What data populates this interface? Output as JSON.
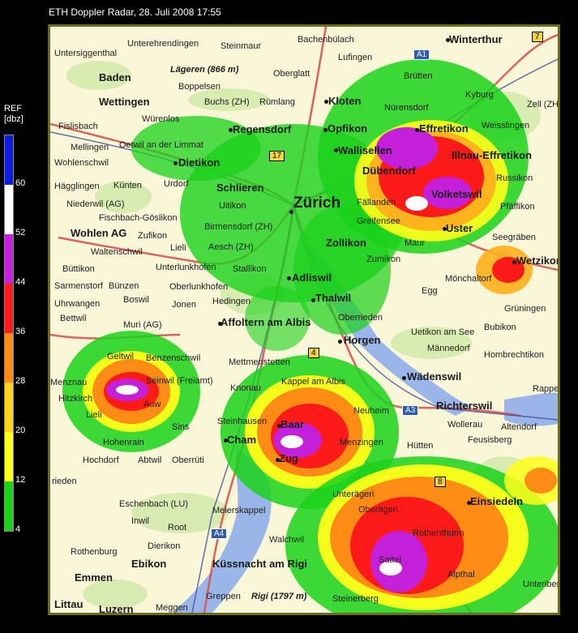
{
  "title": "ETH Doppler Radar, 28. Juli 2008 17:55",
  "legend": {
    "label_line1": "REF",
    "label_line2": "[dbz]",
    "ticks": [
      "60",
      "52",
      "44",
      "36",
      "28",
      "20",
      "12",
      "4"
    ],
    "colors": [
      "#0a1de0",
      "#ffffff",
      "#c41fd9",
      "#ff1a1a",
      "#ff8c14",
      "#ffd21a",
      "#ffff1a",
      "#1ad21a"
    ]
  },
  "map": {
    "places": [
      {
        "id": "unterehrendingen",
        "text": "Unterehrendingen",
        "cls": ""
      },
      {
        "id": "steinmaur",
        "text": "Steinmaur",
        "cls": ""
      },
      {
        "id": "bachenbulach",
        "text": "Bachenbülach",
        "cls": ""
      },
      {
        "id": "winterthur",
        "text": "Winterthur",
        "cls": "big"
      },
      {
        "id": "untersiggenthal",
        "text": "Untersiggenthal",
        "cls": ""
      },
      {
        "id": "lufingen",
        "text": "Lufingen",
        "cls": ""
      },
      {
        "id": "lagern",
        "text": "Lägeren (866 m)",
        "cls": "it"
      },
      {
        "id": "oberglatt",
        "text": "Oberglatt",
        "cls": ""
      },
      {
        "id": "brutten",
        "text": "Brütten",
        "cls": ""
      },
      {
        "id": "baden",
        "text": "Baden",
        "cls": "big"
      },
      {
        "id": "boppelsen",
        "text": "Boppelsen",
        "cls": ""
      },
      {
        "id": "wettingen",
        "text": "Wettingen",
        "cls": "big"
      },
      {
        "id": "buchs",
        "text": "Buchs (ZH)",
        "cls": ""
      },
      {
        "id": "rumlang",
        "text": "Rümlang",
        "cls": ""
      },
      {
        "id": "kloten",
        "text": "Kloten",
        "cls": "big"
      },
      {
        "id": "nurensdorf",
        "text": "Nürensdorf",
        "cls": ""
      },
      {
        "id": "kyburg",
        "text": "Kyburg",
        "cls": ""
      },
      {
        "id": "zell",
        "text": "Zell (ZH)",
        "cls": ""
      },
      {
        "id": "fislisbach",
        "text": "Fislisbach",
        "cls": ""
      },
      {
        "id": "wurenlos",
        "text": "Würenlos",
        "cls": ""
      },
      {
        "id": "regensdorf",
        "text": "Regensdorf",
        "cls": "big"
      },
      {
        "id": "opfikon",
        "text": "Opfikon",
        "cls": "big"
      },
      {
        "id": "effretikon",
        "text": "Effretikon",
        "cls": "big"
      },
      {
        "id": "weisslingen",
        "text": "Weisslingen",
        "cls": ""
      },
      {
        "id": "mellingen",
        "text": "Mellingen",
        "cls": ""
      },
      {
        "id": "oetwil",
        "text": "Oetwil an der Limmat",
        "cls": ""
      },
      {
        "id": "wallisellen",
        "text": "Wallisellen",
        "cls": "big"
      },
      {
        "id": "illnau",
        "text": "Illnau-Effretikon",
        "cls": "big"
      },
      {
        "id": "wohlenschwil",
        "text": "Wohlenschwil",
        "cls": ""
      },
      {
        "id": "dietikon",
        "text": "Dietikon",
        "cls": "big"
      },
      {
        "id": "dubendorf",
        "text": "Dübendorf",
        "cls": "big"
      },
      {
        "id": "russikon",
        "text": "Russikon",
        "cls": ""
      },
      {
        "id": "hagglingen",
        "text": "Hägglingen",
        "cls": ""
      },
      {
        "id": "kunten",
        "text": "Künten",
        "cls": ""
      },
      {
        "id": "urdorf",
        "text": "Urdorf",
        "cls": ""
      },
      {
        "id": "schlieren",
        "text": "Schlieren",
        "cls": "big"
      },
      {
        "id": "volketswil",
        "text": "Volketswil",
        "cls": "big"
      },
      {
        "id": "niederwil",
        "text": "Niederwil (AG)",
        "cls": ""
      },
      {
        "id": "uitikon",
        "text": "Uitikon",
        "cls": ""
      },
      {
        "id": "zurich",
        "text": "Zürich",
        "cls": "city"
      },
      {
        "id": "fallanden",
        "text": "Fällanden",
        "cls": ""
      },
      {
        "id": "pfaffikon",
        "text": "Pfäffikon",
        "cls": ""
      },
      {
        "id": "fischbach",
        "text": "Fischbach-Göslikon",
        "cls": ""
      },
      {
        "id": "greifensee",
        "text": "Greifensee",
        "cls": ""
      },
      {
        "id": "birmensdorf",
        "text": "Birmensdorf (ZH)",
        "cls": ""
      },
      {
        "id": "uster",
        "text": "Uster",
        "cls": "big"
      },
      {
        "id": "wohlen",
        "text": "Wohlen AG",
        "cls": "big"
      },
      {
        "id": "zufikon",
        "text": "Zufikon",
        "cls": ""
      },
      {
        "id": "seegraben",
        "text": "Seegräben",
        "cls": ""
      },
      {
        "id": "lieli",
        "text": "Lieli",
        "cls": ""
      },
      {
        "id": "aesch",
        "text": "Aesch (ZH)",
        "cls": ""
      },
      {
        "id": "zollikon",
        "text": "Zollikon",
        "cls": "big"
      },
      {
        "id": "maur",
        "text": "Maur",
        "cls": ""
      },
      {
        "id": "waltenschwil",
        "text": "Waltenschwil",
        "cls": ""
      },
      {
        "id": "wetzikon",
        "text": "Wetzikon",
        "cls": "big"
      },
      {
        "id": "buttikon",
        "text": "Büttikon",
        "cls": ""
      },
      {
        "id": "unterlunkhofen",
        "text": "Unterlunkhofen",
        "cls": ""
      },
      {
        "id": "stallikon",
        "text": "Stallikon",
        "cls": ""
      },
      {
        "id": "zumikon",
        "text": "Zumikon",
        "cls": ""
      },
      {
        "id": "adliswil",
        "text": "Adliswil",
        "cls": "big"
      },
      {
        "id": "monchaltorf",
        "text": "Mönchaltorf",
        "cls": ""
      },
      {
        "id": "sarmenstorf",
        "text": "Sarmenstorf",
        "cls": ""
      },
      {
        "id": "bunzen",
        "text": "Bünzen",
        "cls": ""
      },
      {
        "id": "oberlunkhofen",
        "text": "Oberlunkhofen",
        "cls": ""
      },
      {
        "id": "egg",
        "text": "Egg",
        "cls": ""
      },
      {
        "id": "boswil",
        "text": "Boswil",
        "cls": ""
      },
      {
        "id": "hedingen",
        "text": "Hedingen",
        "cls": ""
      },
      {
        "id": "thalwil",
        "text": "Thalwil",
        "cls": "big"
      },
      {
        "id": "uhrwangen",
        "text": "Uhrwangen",
        "cls": ""
      },
      {
        "id": "jonen",
        "text": "Jonen",
        "cls": ""
      },
      {
        "id": "gruningen",
        "text": "Grüningen",
        "cls": ""
      },
      {
        "id": "bettwil",
        "text": "Bettwil",
        "cls": ""
      },
      {
        "id": "oberrieden",
        "text": "Oberrieden",
        "cls": ""
      },
      {
        "id": "affoltern",
        "text": "Affoltern am Albis",
        "cls": "big"
      },
      {
        "id": "muri",
        "text": "Muri (AG)",
        "cls": ""
      },
      {
        "id": "bubikon",
        "text": "Bubikon",
        "cls": ""
      },
      {
        "id": "uetikon",
        "text": "Uetikon am See",
        "cls": ""
      },
      {
        "id": "horgen",
        "text": "Horgen",
        "cls": "big"
      },
      {
        "id": "mannedorf",
        "text": "Männedorf",
        "cls": ""
      },
      {
        "id": "geltwil",
        "text": "Geltwil",
        "cls": ""
      },
      {
        "id": "benzenschwil",
        "text": "Benzenschwil",
        "cls": ""
      },
      {
        "id": "hombrechtikon",
        "text": "Hombrechtikon",
        "cls": ""
      },
      {
        "id": "mettmenstetten",
        "text": "Mettmenstetten",
        "cls": ""
      },
      {
        "id": "wadenswil",
        "text": "Wädenswil",
        "cls": "big"
      },
      {
        "id": "knonau",
        "text": "Knonau",
        "cls": ""
      },
      {
        "id": "kappel",
        "text": "Kappel am Albis",
        "cls": ""
      },
      {
        "id": "beinwil",
        "text": "Beinwil (Freiamt)",
        "cls": ""
      },
      {
        "id": "hitzkirch",
        "text": "Hitzkirch",
        "cls": ""
      },
      {
        "id": "auw",
        "text": "Auw",
        "cls": ""
      },
      {
        "id": "menznau",
        "text": "Menznau",
        "cls": ""
      },
      {
        "id": "richterswil",
        "text": "Richterswil",
        "cls": "big"
      },
      {
        "id": "neuheim",
        "text": "Neuheim",
        "cls": ""
      },
      {
        "id": "rappe",
        "text": "Rappe",
        "cls": ""
      },
      {
        "id": "lieli2",
        "text": "Lieli",
        "cls": ""
      },
      {
        "id": "sins",
        "text": "Sins",
        "cls": ""
      },
      {
        "id": "wollerau",
        "text": "Wollerau",
        "cls": ""
      },
      {
        "id": "altendorf",
        "text": "Altendorf",
        "cls": ""
      },
      {
        "id": "steinhausen",
        "text": "Steinhausen",
        "cls": ""
      },
      {
        "id": "baar",
        "text": "Baar",
        "cls": "big"
      },
      {
        "id": "feusisberg",
        "text": "Feusisberg",
        "cls": ""
      },
      {
        "id": "cham",
        "text": "Cham",
        "cls": "big"
      },
      {
        "id": "hohenrain",
        "text": "Hohenrain",
        "cls": ""
      },
      {
        "id": "menzingen",
        "text": "Menzingen",
        "cls": ""
      },
      {
        "id": "hutten",
        "text": "Hütten",
        "cls": ""
      },
      {
        "id": "hochdorf",
        "text": "Hochdorf",
        "cls": ""
      },
      {
        "id": "abtwil",
        "text": "Abtwil",
        "cls": ""
      },
      {
        "id": "oberruti",
        "text": "Oberrüti",
        "cls": ""
      },
      {
        "id": "zug",
        "text": "Zug",
        "cls": "big"
      },
      {
        "id": "rieden",
        "text": "rieden",
        "cls": ""
      },
      {
        "id": "unterageri",
        "text": "Unterägeri",
        "cls": ""
      },
      {
        "id": "einsiedeln",
        "text": "Einsiedeln",
        "cls": "big"
      },
      {
        "id": "eschenbach",
        "text": "Eschenbach (LU)",
        "cls": ""
      },
      {
        "id": "oberageri",
        "text": "Oberägeri",
        "cls": ""
      },
      {
        "id": "inwil",
        "text": "Inwil",
        "cls": ""
      },
      {
        "id": "meierskappel",
        "text": "Meierskappel",
        "cls": ""
      },
      {
        "id": "root",
        "text": "Root",
        "cls": ""
      },
      {
        "id": "rothenthurm",
        "text": "Rothenthurm",
        "cls": ""
      },
      {
        "id": "walchwil",
        "text": "Walchwil",
        "cls": ""
      },
      {
        "id": "rothenburg",
        "text": "Rothenburg",
        "cls": ""
      },
      {
        "id": "dierikon",
        "text": "Dierikon",
        "cls": ""
      },
      {
        "id": "ebikon",
        "text": "Ebikon",
        "cls": "big"
      },
      {
        "id": "kussnacht",
        "text": "Küssnacht am Rigi",
        "cls": "big"
      },
      {
        "id": "sattel",
        "text": "Sattel",
        "cls": ""
      },
      {
        "id": "emmen",
        "text": "Emmen",
        "cls": "big"
      },
      {
        "id": "alpthal",
        "text": "Alpthal",
        "cls": ""
      },
      {
        "id": "unteriberg",
        "text": "Unteriberg",
        "cls": ""
      },
      {
        "id": "rigi",
        "text": "Rigi (1797 m)",
        "cls": "it"
      },
      {
        "id": "greppen",
        "text": "Greppen",
        "cls": ""
      },
      {
        "id": "steinerberg",
        "text": "Steinerberg",
        "cls": ""
      },
      {
        "id": "littau",
        "text": "Littau",
        "cls": "big"
      },
      {
        "id": "luzern",
        "text": "Luzern",
        "cls": "big"
      },
      {
        "id": "meggen",
        "text": "Meggen",
        "cls": ""
      }
    ],
    "road_shields": [
      {
        "id": "a1",
        "text": "A1",
        "cls": ""
      },
      {
        "id": "r7",
        "text": "7",
        "cls": "y"
      },
      {
        "id": "r17",
        "text": "17",
        "cls": "y"
      },
      {
        "id": "r4",
        "text": "4",
        "cls": "y"
      },
      {
        "id": "a3",
        "text": "A3",
        "cls": ""
      },
      {
        "id": "r8",
        "text": "8",
        "cls": "y"
      },
      {
        "id": "a4",
        "text": "A4",
        "cls": ""
      }
    ]
  }
}
